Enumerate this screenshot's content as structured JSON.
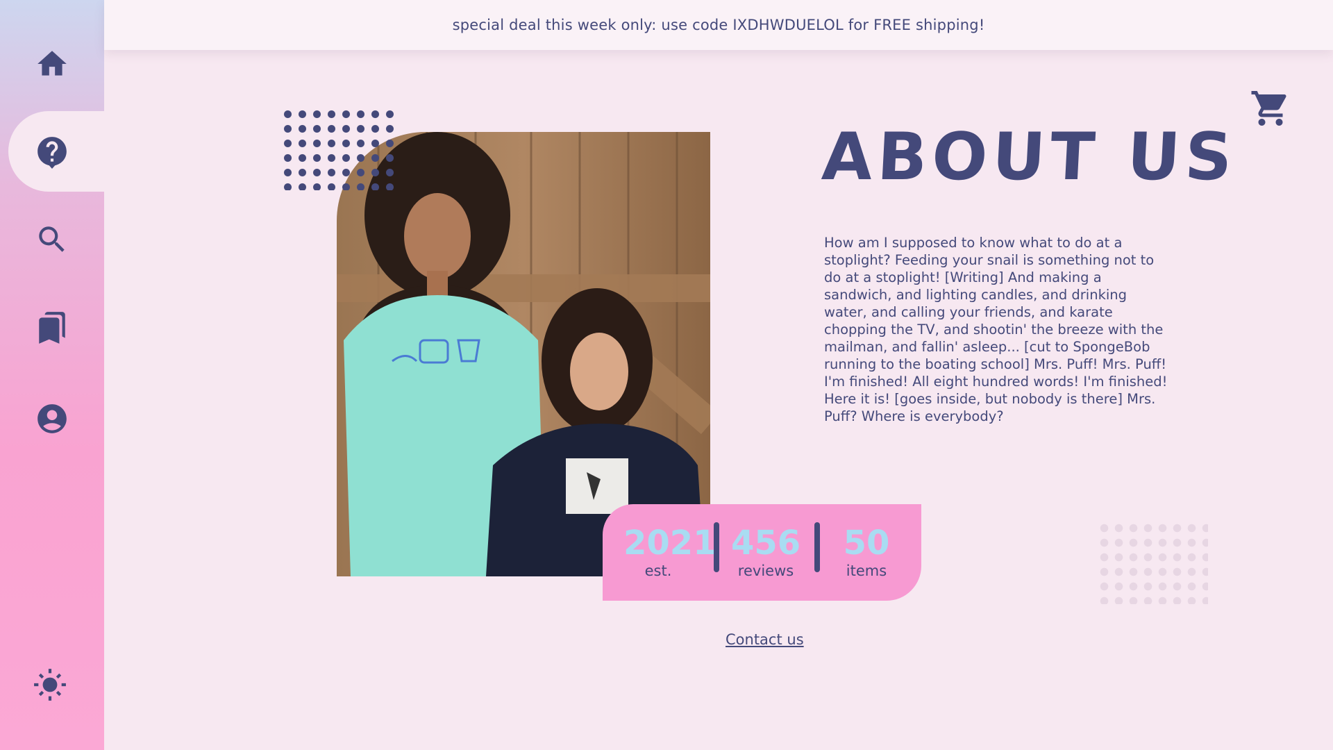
{
  "banner": {
    "text": "special deal this week only: use code IXDHWDUELOL for FREE shipping!"
  },
  "sidebar": {
    "items": [
      {
        "icon": "home-icon",
        "active": false
      },
      {
        "icon": "help-icon",
        "active": true
      },
      {
        "icon": "search-icon",
        "active": false
      },
      {
        "icon": "bookmarks-icon",
        "active": false
      },
      {
        "icon": "account-icon",
        "active": false
      }
    ],
    "theme_icon": "sun-icon"
  },
  "header": {
    "cart_icon": "cart-icon"
  },
  "about": {
    "title": "ABOUT US",
    "body": "How am I supposed to know what to do at a stoplight? Feeding your snail is something not to do at a stoplight! [Writing] And making a sandwich, and lighting candles, and drinking water, and calling your friends, and karate chopping the TV, and shootin' the breeze with the mailman, and fallin' asleep... [cut to SpongeBob running to the boating school] Mrs. Puff! Mrs. Puff! I'm finished! All eight hundred words! I'm finished! Here it is! [goes inside, but nobody is there] Mrs. Puff? Where is everybody?"
  },
  "stats": [
    {
      "value": "2021",
      "label": "est."
    },
    {
      "value": "456",
      "label": "reviews"
    },
    {
      "value": "50",
      "label": "items"
    }
  ],
  "contact": {
    "label": "Contact us"
  },
  "colors": {
    "primary": "#44497a",
    "background": "#f7e8f1",
    "pink": "#f79ad2",
    "stat_value": "#a9dcf2"
  }
}
